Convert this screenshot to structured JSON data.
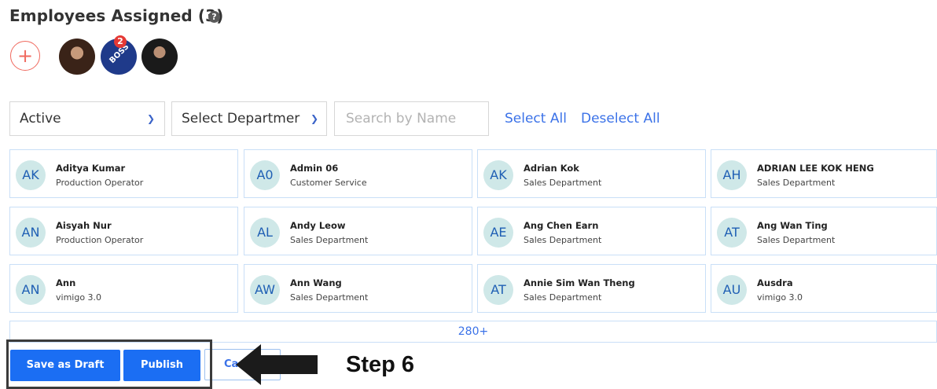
{
  "header": {
    "title": "Employees Assigned (3)",
    "help_icon": "?"
  },
  "assigned": {
    "add_label": "+",
    "badge_count": "2",
    "avatar2_text": "BOSS"
  },
  "filters": {
    "status": "Active",
    "department": "Select Departmer",
    "search_placeholder": "Search by Name",
    "select_all": "Select All",
    "deselect_all": "Deselect All"
  },
  "employees": [
    {
      "initials": "AK",
      "name": "Aditya Kumar",
      "dept": "Production Operator"
    },
    {
      "initials": "A0",
      "name": "Admin 06",
      "dept": "Customer Service"
    },
    {
      "initials": "AK",
      "name": "Adrian Kok",
      "dept": "Sales Department"
    },
    {
      "initials": "AH",
      "name": "ADRIAN LEE KOK HENG",
      "dept": "Sales Department"
    },
    {
      "initials": "AN",
      "name": "Aisyah Nur",
      "dept": "Production Operator"
    },
    {
      "initials": "AL",
      "name": "Andy Leow",
      "dept": "Sales Department"
    },
    {
      "initials": "AE",
      "name": "Ang Chen Earn",
      "dept": "Sales Department"
    },
    {
      "initials": "AT",
      "name": "Ang Wan Ting",
      "dept": "Sales Department"
    },
    {
      "initials": "AN",
      "name": "Ann",
      "dept": "vimigo 3.0"
    },
    {
      "initials": "AW",
      "name": "Ann Wang",
      "dept": "Sales Department"
    },
    {
      "initials": "AT",
      "name": "Annie Sim Wan Theng",
      "dept": "Sales Department"
    },
    {
      "initials": "AU",
      "name": "Ausdra",
      "dept": "vimigo 3.0"
    }
  ],
  "more_label": "280+",
  "actions": {
    "save_draft": "Save as Draft",
    "publish": "Publish",
    "cancel": "Ca"
  },
  "annotation": {
    "step_label": "Step 6"
  },
  "colors": {
    "primary": "#1b6ef3",
    "link": "#3b72e8",
    "add_accent": "#f06a5f",
    "avatar_bg": "#cfe8e8"
  }
}
